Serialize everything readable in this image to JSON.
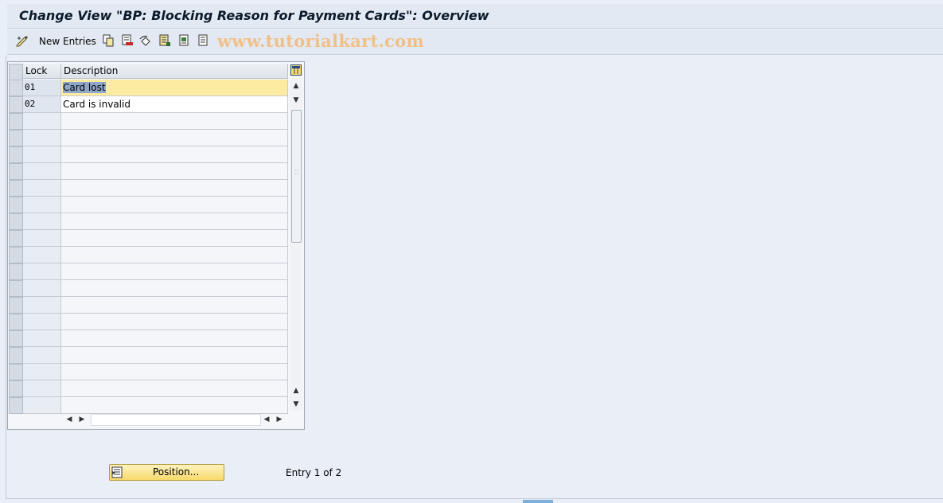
{
  "title": "Change View \"BP: Blocking Reason for Payment Cards\": Overview",
  "toolbar": {
    "new_entries_label": "New Entries",
    "watermark": "www.tutorialkart.com",
    "icons": [
      "display-change-icon",
      "copy-icon",
      "delete-icon",
      "undo-icon",
      "select-all-icon",
      "select-block-icon",
      "deselect-all-icon"
    ]
  },
  "table": {
    "headers": {
      "lock": "Lock",
      "description": "Description"
    },
    "rows": [
      {
        "lock": "01",
        "description": "Card lost"
      },
      {
        "lock": "02",
        "description": "Card is invalid"
      }
    ],
    "visible_row_count": 20
  },
  "footer": {
    "position_label": "Position...",
    "entry_text": "Entry 1 of 2"
  },
  "colors": {
    "background": "#eaeff7",
    "selected_row": "#fdeba1",
    "button": "#f7d96a"
  }
}
